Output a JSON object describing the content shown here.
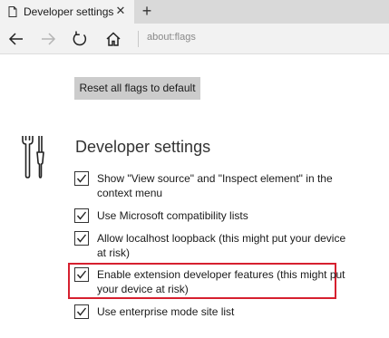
{
  "browser": {
    "tab_title": "Developer settings",
    "tab_close_glyph": "✕",
    "new_tab_glyph": "+",
    "address": "about:flags",
    "icons": {
      "back": "back-arrow-icon",
      "forward": "forward-arrow-icon",
      "refresh": "refresh-icon",
      "home": "home-icon",
      "tab_favicon": "page-favicon-icon"
    }
  },
  "flags_page": {
    "reset_button_label": "Reset all flags to default",
    "section_title": "Developer settings",
    "section_icon": "wrench-screwdriver-icon",
    "flags": [
      {
        "label": "Show \"View source\" and \"Inspect element\" in the context menu",
        "checked": true
      },
      {
        "label": "Use Microsoft compatibility lists",
        "checked": true
      },
      {
        "label": "Allow localhost loopback (this might put your device at risk)",
        "checked": true
      },
      {
        "label": "Enable extension developer features (this might put your device at risk)",
        "checked": true,
        "highlighted": true
      },
      {
        "label": "Use enterprise mode site list",
        "checked": true
      }
    ],
    "highlight_color": "#d6202f"
  }
}
